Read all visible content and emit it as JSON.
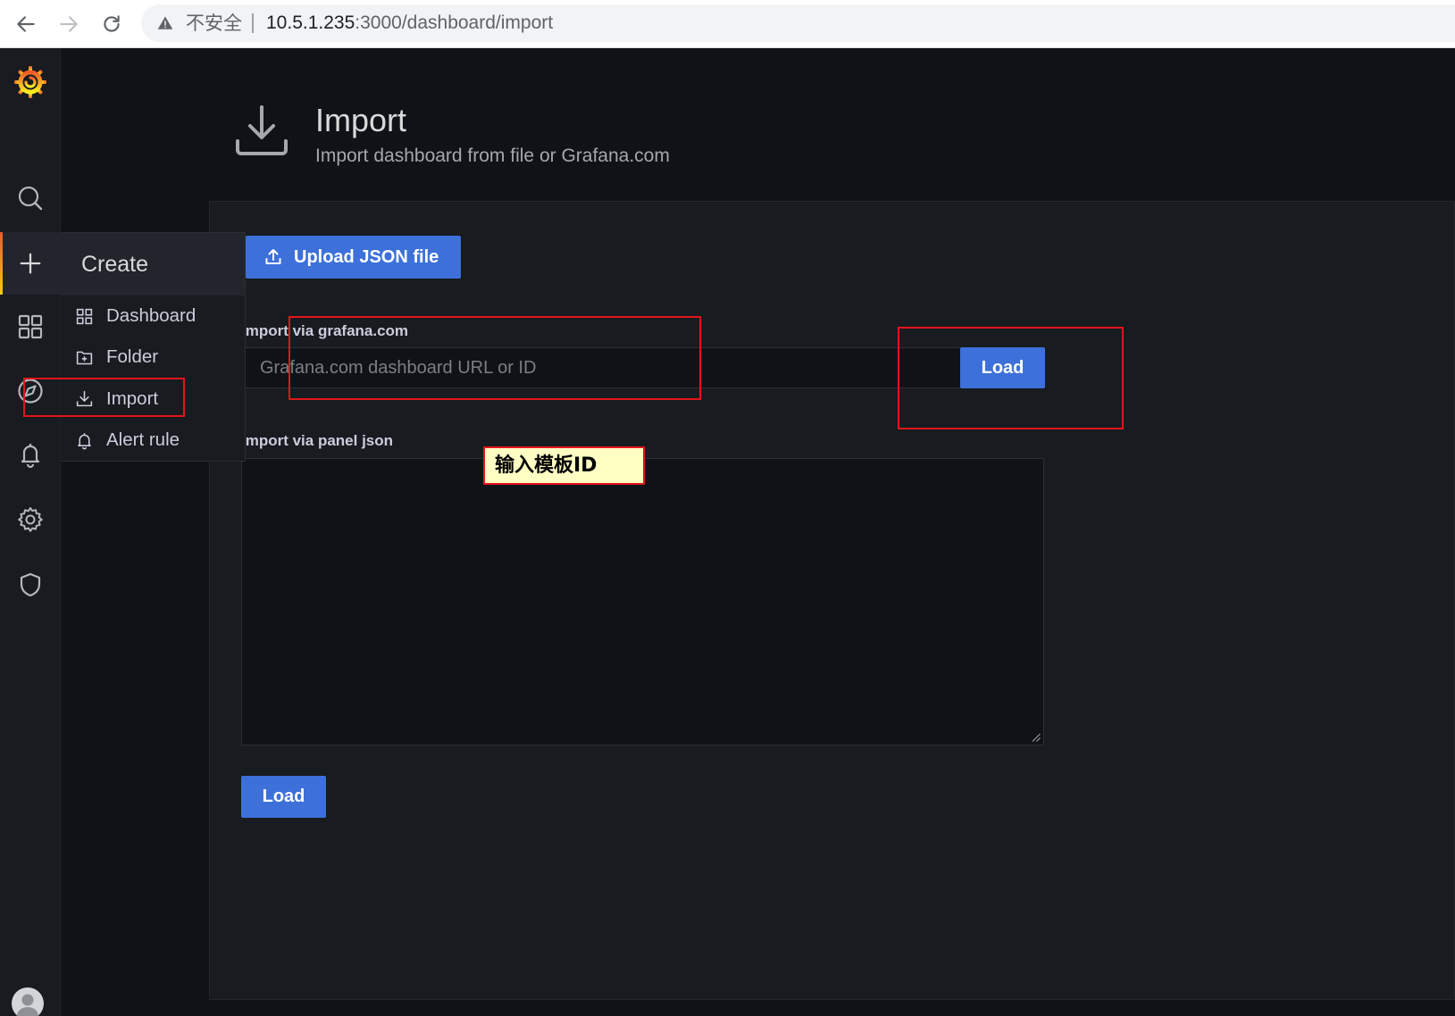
{
  "browser": {
    "back_icon": "arrow-left-icon",
    "forward_icon": "arrow-right-icon",
    "reload_icon": "reload-icon",
    "security_icon": "warning-triangle-icon",
    "security_label": "不安全",
    "url_host": "10.5.1.235",
    "url_rest": ":3000/dashboard/import"
  },
  "sidebar": {
    "logo_icon": "grafana-logo",
    "items": [
      {
        "icon": "search-icon"
      },
      {
        "icon": "plus-icon",
        "active": true
      },
      {
        "icon": "apps-icon"
      },
      {
        "icon": "compass-icon"
      },
      {
        "icon": "bell-icon"
      },
      {
        "icon": "gear-icon"
      },
      {
        "icon": "shield-icon"
      }
    ],
    "profile_icon": "avatar"
  },
  "create_menu": {
    "title": "Create",
    "items": [
      {
        "label": "Dashboard",
        "icon": "apps-icon"
      },
      {
        "label": "Folder",
        "icon": "folder-plus-icon"
      },
      {
        "label": "Import",
        "icon": "import-icon"
      },
      {
        "label": "Alert rule",
        "icon": "bell-icon"
      }
    ]
  },
  "page_header": {
    "icon": "import-icon",
    "title": "Import",
    "subtitle": "Import dashboard from file or Grafana.com"
  },
  "import_form": {
    "upload_button": "Upload JSON file",
    "upload_icon": "upload-icon",
    "grafana_com": {
      "label": "Import via grafana.com",
      "placeholder": "Grafana.com dashboard URL or ID",
      "load_button": "Load"
    },
    "panel_json": {
      "label": "Import via panel json",
      "load_button": "Load"
    }
  },
  "annotations": {
    "callout": "输入模板ID"
  },
  "colors": {
    "accent_blue": "#3d71d9",
    "active_orange": "#f05a28",
    "annotation_red": "#e4141b",
    "callout_bg": "#ffffc4",
    "page_bg": "#111217",
    "panel_bg": "#181b1f"
  }
}
